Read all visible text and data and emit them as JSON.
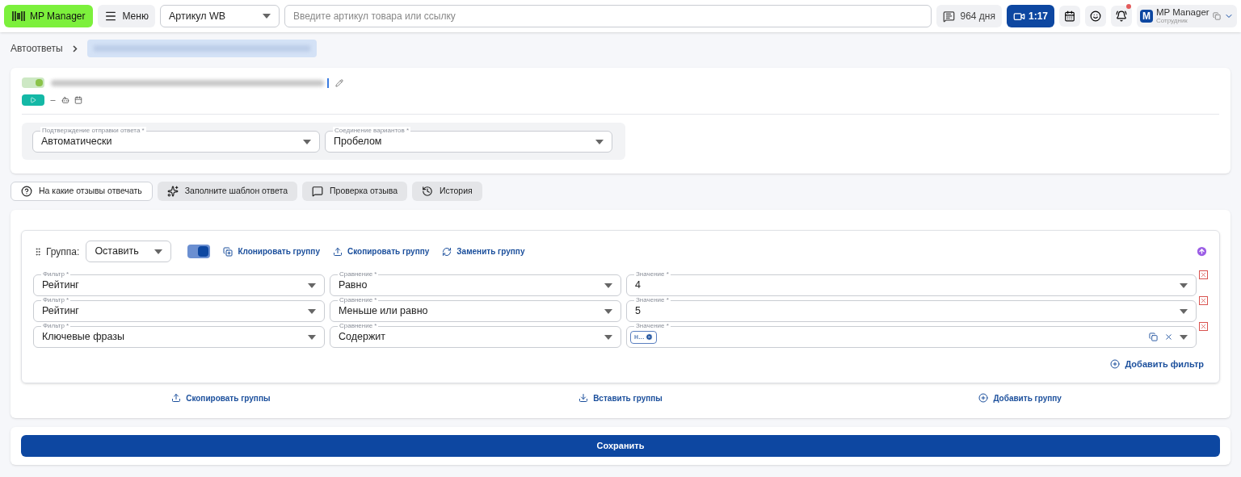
{
  "topbar": {
    "logo": "MP Manager",
    "menu": "Меню",
    "search_type": "Артикул WB",
    "search_placeholder": "Введите артикул товара или ссылку",
    "subscription": "964 дня",
    "video": "1:17",
    "has_notifications": true,
    "user": {
      "avatar": "M",
      "name": "MP Manager",
      "role": "Сотрудник"
    }
  },
  "breadcrumb": {
    "root": "Автоответы"
  },
  "autoreply": {
    "enabled": true,
    "settings": [
      {
        "label": "Подтверждение отправки ответа *",
        "value": "Автоматически"
      },
      {
        "label": "Соединение вариантов *",
        "value": "Пробелом"
      }
    ]
  },
  "tabs": [
    {
      "label": "На какие отзывы отвечать",
      "selected": true
    },
    {
      "label": "Заполните шаблон ответа",
      "selected": false
    },
    {
      "label": "Проверка отзыва",
      "selected": false
    },
    {
      "label": "История",
      "selected": false
    }
  ],
  "group": {
    "label": "Группа:",
    "action": "Оставить",
    "enabled": true,
    "actions": [
      "Клонировать группу",
      "Скопировать группу",
      "Заменить группу"
    ],
    "filters": [
      {
        "filter": {
          "label": "Фильтр *",
          "value": "Рейтинг"
        },
        "comparison": {
          "label": "Сравнение *",
          "value": "Равно"
        },
        "value": {
          "label": "Значение *",
          "value": "4"
        }
      },
      {
        "filter": {
          "label": "Фильтр *",
          "value": "Рейтинг"
        },
        "comparison": {
          "label": "Сравнение *",
          "value": "Меньше или равно"
        },
        "value": {
          "label": "Значение *",
          "value": "5"
        }
      },
      {
        "filter": {
          "label": "Фильтр *",
          "value": "Ключевые фразы"
        },
        "comparison": {
          "label": "Сравнение *",
          "value": "Содержит"
        },
        "value": {
          "label": "Значение *",
          "chips": [
            "н..."
          ]
        }
      }
    ],
    "add_filter": "Добавить фильтр"
  },
  "footer_actions": [
    "Скопировать группы",
    "Вставить группы",
    "Добавить группу"
  ],
  "save": "Сохранить"
}
